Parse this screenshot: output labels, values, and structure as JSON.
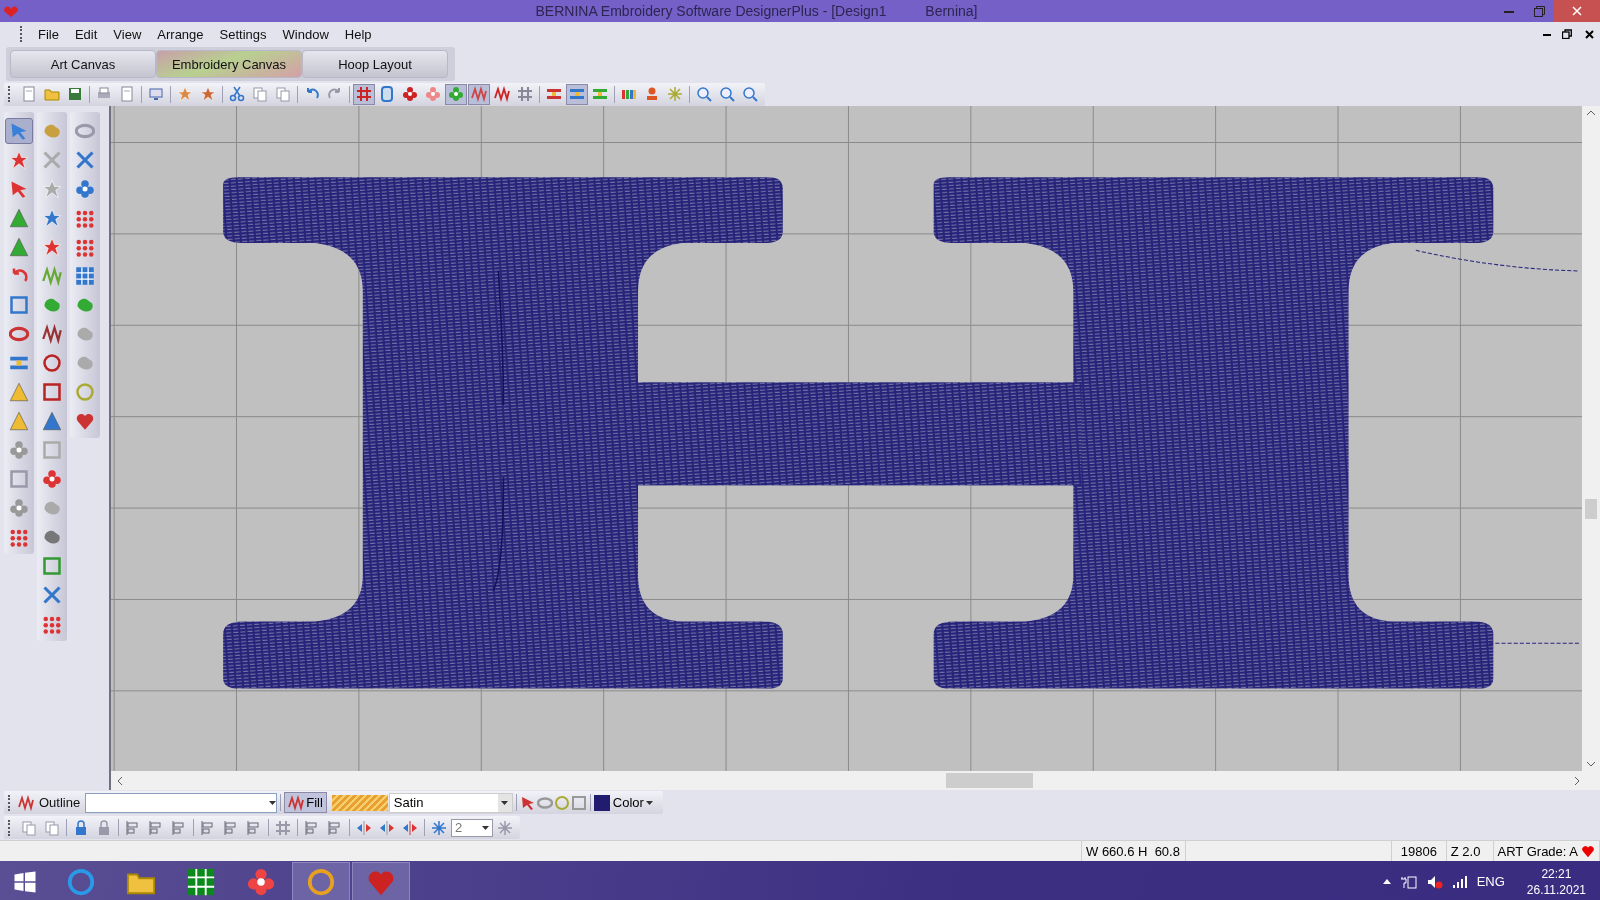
{
  "window": {
    "title": "BERNINA Embroidery Software DesignerPlus - [Design1          Bernina]"
  },
  "menu": [
    "File",
    "Edit",
    "View",
    "Arrange",
    "Settings",
    "Window",
    "Help"
  ],
  "canvas_tabs": [
    {
      "label": "Art Canvas",
      "selected": false
    },
    {
      "label": "Embroidery Canvas",
      "selected": true
    },
    {
      "label": "Hoop Layout",
      "selected": false
    }
  ],
  "main_toolbar": [
    {
      "pressed": false
    },
    {
      "pressed": false
    },
    {
      "pressed": false
    },
    {
      "pressed": false
    },
    {
      "pressed": false
    },
    {
      "pressed": false
    },
    {
      "pressed": false
    },
    {
      "pressed": false
    },
    {
      "pressed": false
    },
    {
      "pressed": false
    },
    {
      "pressed": false
    },
    {
      "pressed": false
    },
    {
      "pressed": false
    },
    {
      "pressed": true
    },
    {
      "pressed": false
    },
    {
      "pressed": false
    },
    {
      "pressed": false
    },
    {
      "pressed": true
    },
    {
      "pressed": true
    },
    {
      "pressed": false
    },
    {
      "pressed": false
    },
    {
      "pressed": false
    },
    {
      "pressed": true
    },
    {
      "pressed": false
    },
    {
      "pressed": false
    },
    {
      "pressed": false
    },
    {
      "pressed": false
    },
    {
      "pressed": false
    },
    {
      "pressed": false
    },
    {
      "pressed": false
    }
  ],
  "tool_columns": [
    {
      "buttons": [
        {
          "pressed": true
        },
        {
          "pressed": false
        },
        {
          "pressed": false
        },
        {
          "pressed": false
        },
        {
          "pressed": false
        },
        {
          "pressed": false
        },
        {
          "pressed": false
        },
        {
          "pressed": false
        },
        {
          "pressed": false
        },
        {
          "pressed": false
        },
        {
          "pressed": false
        },
        {
          "pressed": false
        },
        {
          "pressed": false
        },
        {
          "pressed": false
        },
        {
          "pressed": false
        }
      ]
    },
    {
      "buttons": [
        {
          "pressed": false
        },
        {
          "pressed": false
        },
        {
          "pressed": false
        },
        {
          "pressed": false
        },
        {
          "pressed": false
        },
        {
          "pressed": false
        },
        {
          "pressed": false
        },
        {
          "pressed": false
        },
        {
          "pressed": false
        },
        {
          "pressed": false
        },
        {
          "pressed": false
        },
        {
          "pressed": false
        },
        {
          "pressed": false
        },
        {
          "pressed": false
        },
        {
          "pressed": false
        },
        {
          "pressed": false
        },
        {
          "pressed": false
        },
        {
          "pressed": false
        }
      ]
    },
    {
      "buttons": [
        {
          "pressed": false
        },
        {
          "pressed": false
        },
        {
          "pressed": false
        },
        {
          "pressed": false
        },
        {
          "pressed": false
        },
        {
          "pressed": false
        },
        {
          "pressed": false
        },
        {
          "pressed": false
        },
        {
          "pressed": false
        },
        {
          "pressed": false
        },
        {
          "pressed": false
        }
      ]
    }
  ],
  "properties_toolbar": {
    "outline_label": "Outline",
    "fill_label": "Fill",
    "fill_pressed": true,
    "fill_type": "Satin",
    "color_label": "Color",
    "thread": {
      "color": "#221c6e"
    }
  },
  "arrange_toolbar": {
    "count": "2"
  },
  "status_bar": {
    "size": "W 660.6 H  60.8",
    "stitches": "19806",
    "zoom": "Z 2.0",
    "grade": "ART Grade: A"
  },
  "taskbar": {
    "apps": [
      {
        "active": false
      },
      {
        "active": false
      },
      {
        "active": false
      },
      {
        "active": false
      },
      {
        "active": true
      },
      {
        "active": true
      }
    ],
    "language": "ENG",
    "time": "22:21",
    "date": "26.11.2021"
  }
}
